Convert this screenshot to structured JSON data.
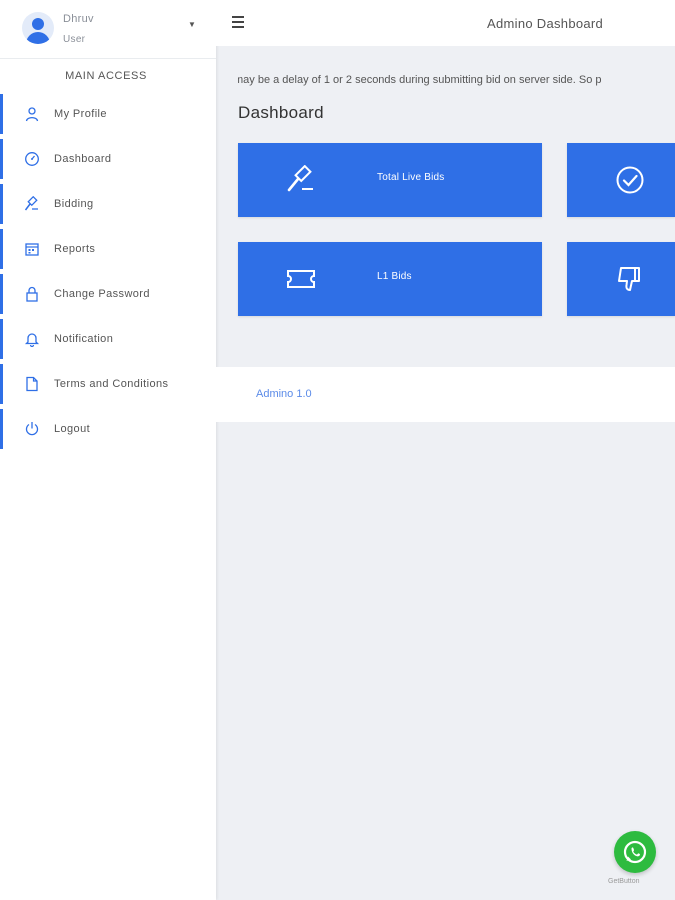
{
  "user": {
    "name": "Dhruv",
    "role": "User"
  },
  "sidebar": {
    "section_title": "MAIN ACCESS",
    "items": [
      {
        "label": "My Profile",
        "icon": "user-icon"
      },
      {
        "label": "Dashboard",
        "icon": "dashboard-icon"
      },
      {
        "label": "Bidding",
        "icon": "gavel-icon"
      },
      {
        "label": "Reports",
        "icon": "reports-icon"
      },
      {
        "label": "Change Password",
        "icon": "lock-icon"
      },
      {
        "label": "Notification",
        "icon": "bell-icon"
      },
      {
        "label": "Terms and Conditions",
        "icon": "document-icon"
      },
      {
        "label": "Logout",
        "icon": "power-icon"
      }
    ]
  },
  "header": {
    "title": "Admino Dashboard"
  },
  "main": {
    "notice": "may be a delay of 1 or 2 seconds during submitting bid on server side. So p",
    "title": "Dashboard",
    "cards": [
      {
        "label": "Total Live Bids",
        "icon": "gavel-icon"
      },
      {
        "label": "",
        "icon": "check-circle-icon"
      },
      {
        "label": "L1 Bids",
        "icon": "ticket-icon"
      },
      {
        "label": "",
        "icon": "thumbs-down-icon"
      }
    ]
  },
  "footer": {
    "text": "Admino 1.0"
  },
  "whatsapp": {
    "label": "GetButton",
    "icon": "whatsapp-icon"
  },
  "colors": {
    "accent": "#2f6fe6",
    "background": "#eef0f4",
    "whatsapp": "#2dbb3f"
  }
}
